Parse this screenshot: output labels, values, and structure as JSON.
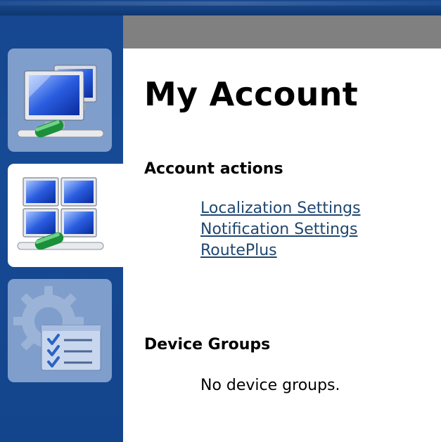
{
  "page": {
    "title": "My Account"
  },
  "sidebar": {
    "items": [
      {
        "icon": "network-computers-icon",
        "active": false
      },
      {
        "icon": "device-grid-icon",
        "active": true
      },
      {
        "icon": "settings-checklist-icon",
        "active": false
      }
    ]
  },
  "sections": {
    "account_actions": {
      "title": "Account actions",
      "links": [
        "Localization Settings",
        "Notification Settings",
        "RoutePlus"
      ]
    },
    "device_groups": {
      "title": "Device Groups",
      "empty_message": "No device groups."
    }
  },
  "colors": {
    "sidebar_bg": "#164790",
    "tile_bg": "#7f9ecb",
    "active_tile_bg": "#ffffff",
    "header_strip": "#808080",
    "link": "#1f4771"
  }
}
